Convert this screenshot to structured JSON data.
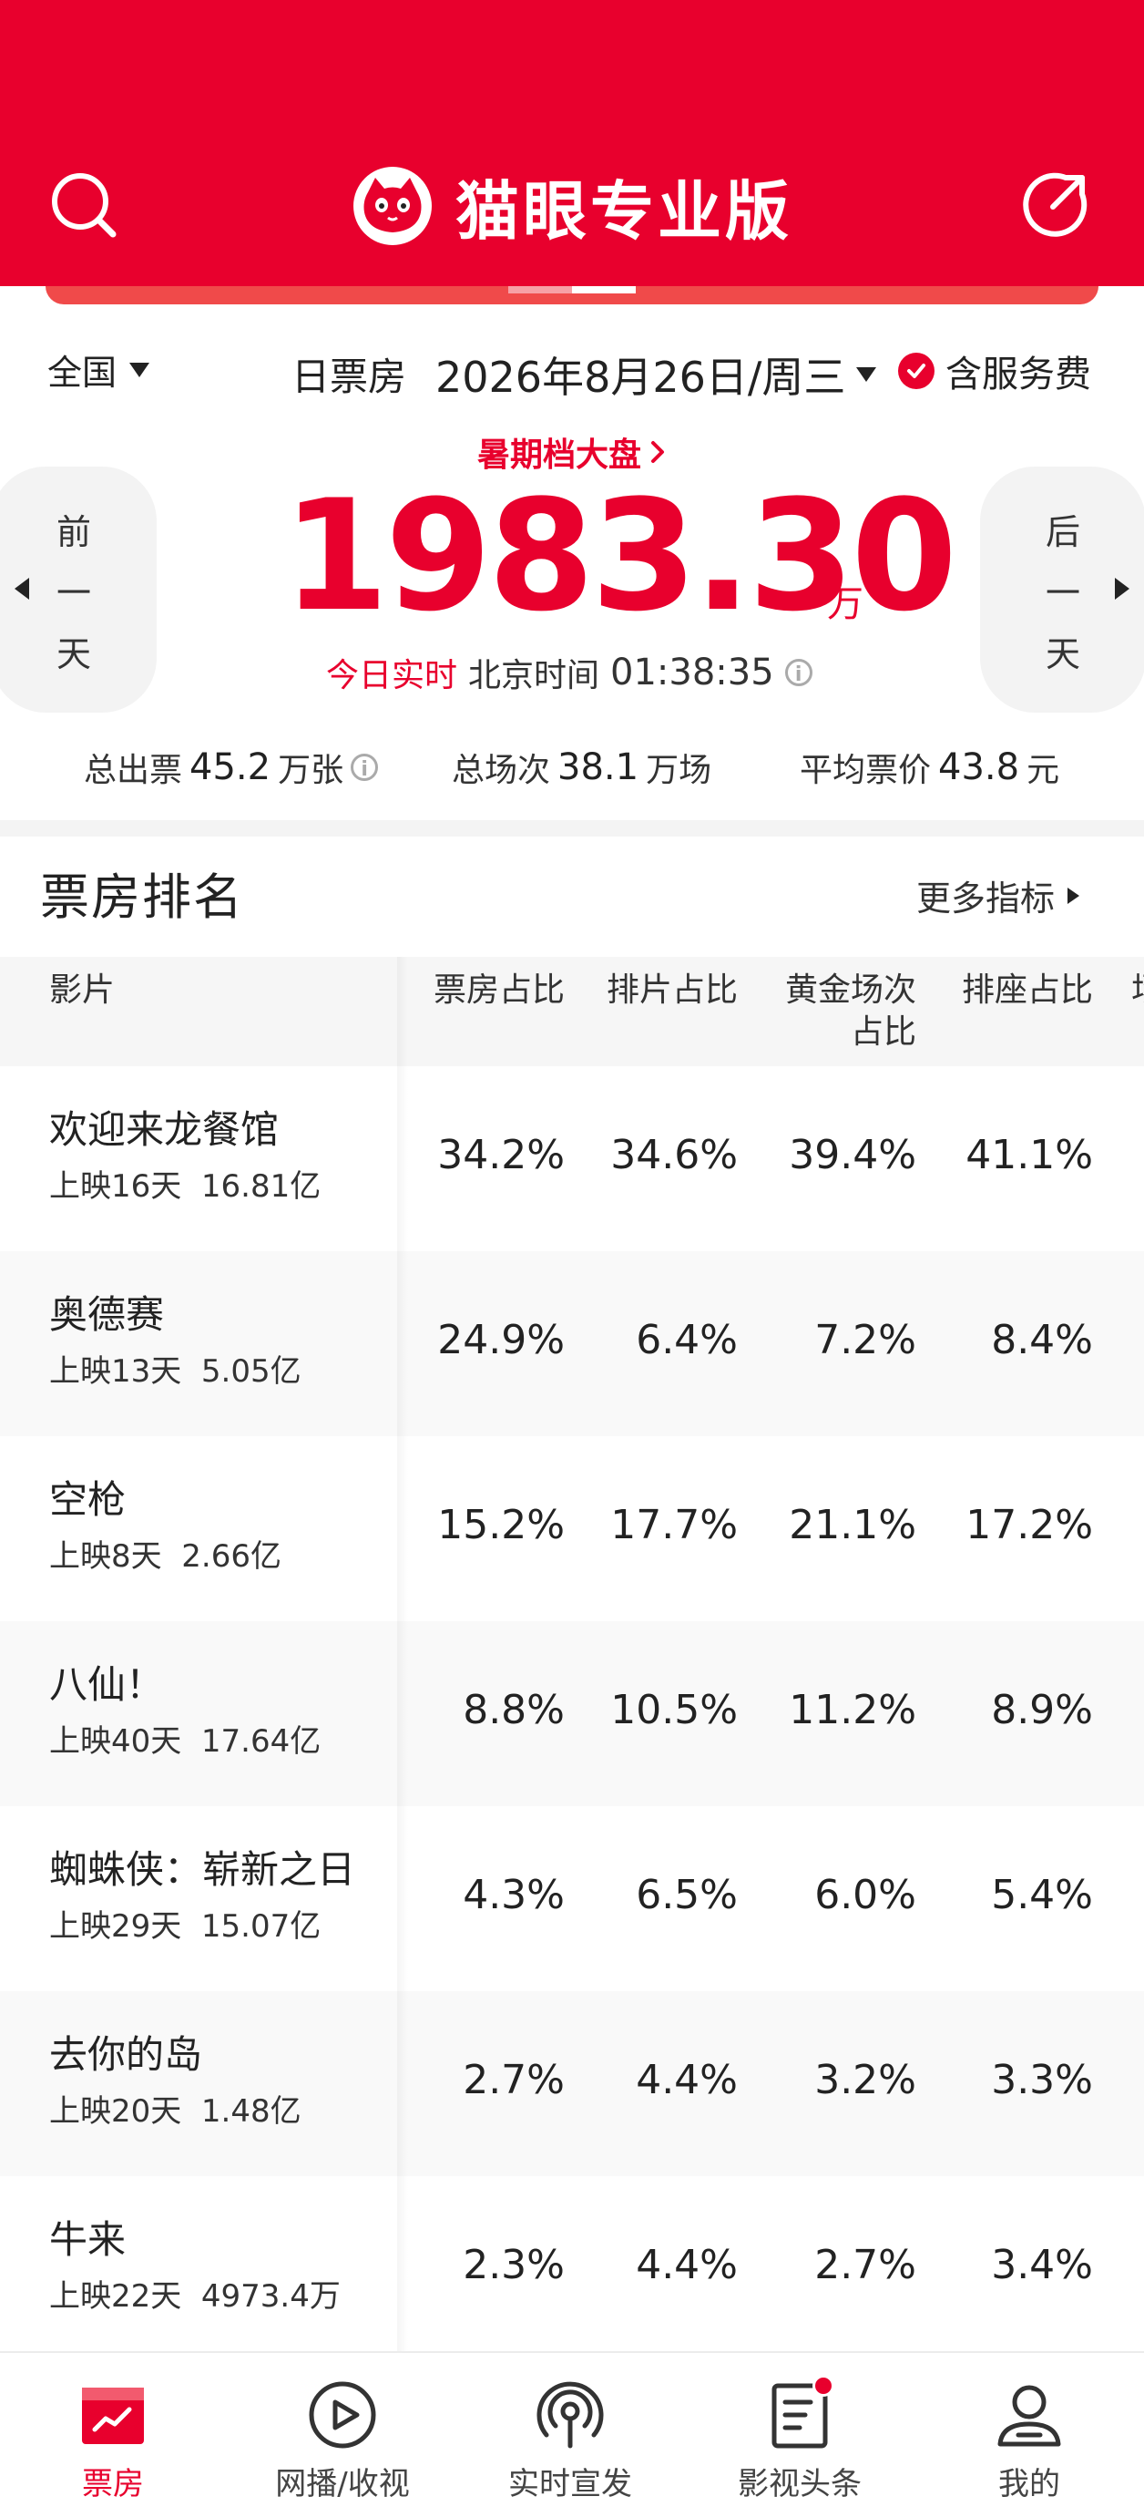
{
  "header": {
    "app_title": "猫眼专业版",
    "colors": {
      "brand": "#e8002d",
      "banner": "#f04a4a"
    },
    "icons": {
      "left": "search-icon",
      "right": "share-icon",
      "logo": "cat-logo-icon"
    }
  },
  "filters": {
    "region": "全国",
    "type": "日票房",
    "date": "2026年8月26日/周三",
    "service_fee": "含服务费",
    "service_fee_checked": true
  },
  "summary": {
    "season_link": "暑期档大盘",
    "box_office": "1983.30",
    "unit": "万",
    "realtime_label": "今日实时",
    "beijing_time_label": "北京时间",
    "time": "01:38:35",
    "prev_day": [
      "前",
      "一",
      "天"
    ],
    "next_day": [
      "后",
      "一",
      "天"
    ]
  },
  "stats": {
    "tickets_label": "总出票",
    "tickets_value": "45.2",
    "tickets_unit": "万张",
    "shows_label": "总场次",
    "shows_value": "38.1",
    "shows_unit": "万场",
    "price_label": "平均票价",
    "price_value": "43.8",
    "price_unit": "元"
  },
  "ranking": {
    "title": "票房排名",
    "more": "更多指标",
    "columns": {
      "film": "影片",
      "c1": "票房占比",
      "c2": "排片占比",
      "c3_line1": "黄金场次",
      "c3_line2": "占比",
      "c4": "排座占比",
      "c5": "场"
    },
    "rows": [
      {
        "name": "欢迎来龙餐馆",
        "days": "上映16天",
        "total": "16.81亿",
        "c1": "34.2%",
        "c2": "34.6%",
        "c3": "39.4%",
        "c4": "41.1%"
      },
      {
        "name": "奥德赛",
        "days": "上映13天",
        "total": "5.05亿",
        "c1": "24.9%",
        "c2": "6.4%",
        "c3": "7.2%",
        "c4": "8.4%"
      },
      {
        "name": "空枪",
        "days": "上映8天",
        "total": "2.66亿",
        "c1": "15.2%",
        "c2": "17.7%",
        "c3": "21.1%",
        "c4": "17.2%"
      },
      {
        "name": "八仙！",
        "days": "上映40天",
        "total": "17.64亿",
        "c1": "8.8%",
        "c2": "10.5%",
        "c3": "11.2%",
        "c4": "8.9%"
      },
      {
        "name": "蜘蛛侠：崭新之日",
        "days": "上映29天",
        "total": "15.07亿",
        "c1": "4.3%",
        "c2": "6.5%",
        "c3": "6.0%",
        "c4": "5.4%"
      },
      {
        "name": "去你的岛",
        "days": "上映20天",
        "total": "1.48亿",
        "c1": "2.7%",
        "c2": "4.4%",
        "c3": "3.2%",
        "c4": "3.3%"
      },
      {
        "name": "牛来",
        "days": "上映22天",
        "total": "4973.4万",
        "c1": "2.3%",
        "c2": "4.4%",
        "c3": "2.7%",
        "c4": "3.4%"
      }
    ]
  },
  "tabbar": {
    "tabs": [
      {
        "label": "票房",
        "icon": "box-office-icon",
        "active": true
      },
      {
        "label": "网播/收视",
        "icon": "play-icon"
      },
      {
        "label": "实时宣发",
        "icon": "broadcast-icon"
      },
      {
        "label": "影视头条",
        "icon": "news-icon",
        "badge": true
      },
      {
        "label": "我的",
        "icon": "profile-icon"
      }
    ]
  }
}
